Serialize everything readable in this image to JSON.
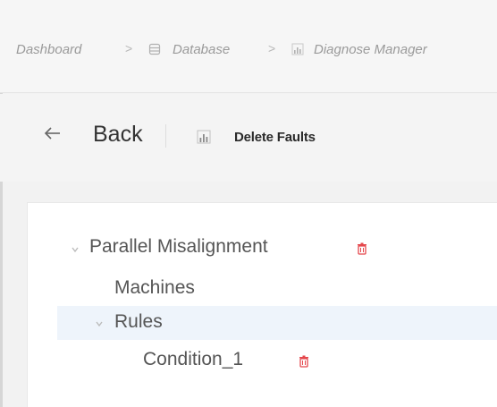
{
  "breadcrumb": {
    "items": [
      {
        "label": "Dashboard",
        "icon": "none"
      },
      {
        "label": "Database",
        "icon": "database-icon"
      },
      {
        "label": "Diagnose Manager",
        "icon": "chart-icon"
      }
    ],
    "separator": ">"
  },
  "header": {
    "back_label": "Back",
    "title": "Delete Faults",
    "title_icon": "chart-icon"
  },
  "tree": {
    "root": {
      "label": "Parallel Misalignment",
      "expanded": true,
      "deletable": true
    },
    "machines": {
      "label": "Machines"
    },
    "rules": {
      "label": "Rules",
      "expanded": true,
      "selected": true
    },
    "condition": {
      "label": "Condition_1",
      "deletable": true
    }
  },
  "colors": {
    "delete": "#e5484d",
    "selected_row": "#eef4fb",
    "text": "#555555"
  }
}
